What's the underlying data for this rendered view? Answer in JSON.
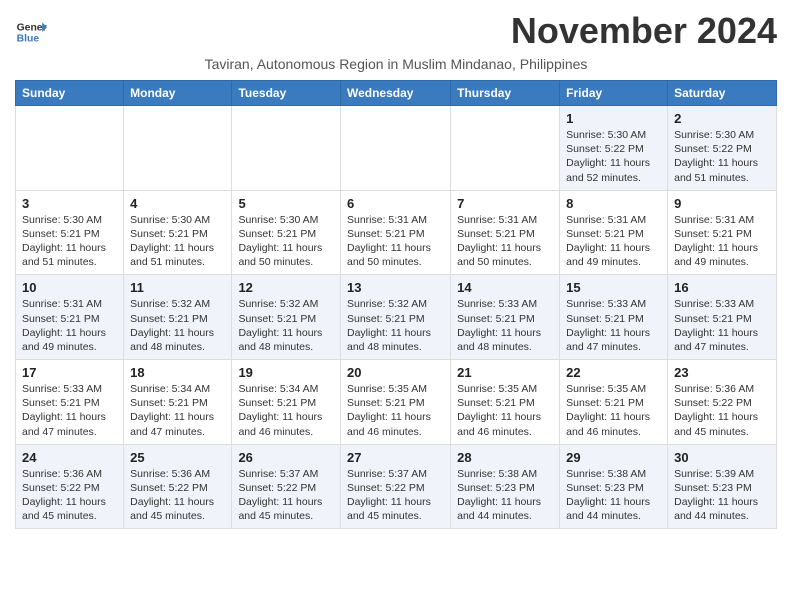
{
  "logo": {
    "line1": "General",
    "line2": "Blue"
  },
  "title": "November 2024",
  "subtitle": "Taviran, Autonomous Region in Muslim Mindanao, Philippines",
  "headers": [
    "Sunday",
    "Monday",
    "Tuesday",
    "Wednesday",
    "Thursday",
    "Friday",
    "Saturday"
  ],
  "weeks": [
    [
      {
        "day": "",
        "info": ""
      },
      {
        "day": "",
        "info": ""
      },
      {
        "day": "",
        "info": ""
      },
      {
        "day": "",
        "info": ""
      },
      {
        "day": "",
        "info": ""
      },
      {
        "day": "1",
        "info": "Sunrise: 5:30 AM\nSunset: 5:22 PM\nDaylight: 11 hours\nand 52 minutes."
      },
      {
        "day": "2",
        "info": "Sunrise: 5:30 AM\nSunset: 5:22 PM\nDaylight: 11 hours\nand 51 minutes."
      }
    ],
    [
      {
        "day": "3",
        "info": "Sunrise: 5:30 AM\nSunset: 5:21 PM\nDaylight: 11 hours\nand 51 minutes."
      },
      {
        "day": "4",
        "info": "Sunrise: 5:30 AM\nSunset: 5:21 PM\nDaylight: 11 hours\nand 51 minutes."
      },
      {
        "day": "5",
        "info": "Sunrise: 5:30 AM\nSunset: 5:21 PM\nDaylight: 11 hours\nand 50 minutes."
      },
      {
        "day": "6",
        "info": "Sunrise: 5:31 AM\nSunset: 5:21 PM\nDaylight: 11 hours\nand 50 minutes."
      },
      {
        "day": "7",
        "info": "Sunrise: 5:31 AM\nSunset: 5:21 PM\nDaylight: 11 hours\nand 50 minutes."
      },
      {
        "day": "8",
        "info": "Sunrise: 5:31 AM\nSunset: 5:21 PM\nDaylight: 11 hours\nand 49 minutes."
      },
      {
        "day": "9",
        "info": "Sunrise: 5:31 AM\nSunset: 5:21 PM\nDaylight: 11 hours\nand 49 minutes."
      }
    ],
    [
      {
        "day": "10",
        "info": "Sunrise: 5:31 AM\nSunset: 5:21 PM\nDaylight: 11 hours\nand 49 minutes."
      },
      {
        "day": "11",
        "info": "Sunrise: 5:32 AM\nSunset: 5:21 PM\nDaylight: 11 hours\nand 48 minutes."
      },
      {
        "day": "12",
        "info": "Sunrise: 5:32 AM\nSunset: 5:21 PM\nDaylight: 11 hours\nand 48 minutes."
      },
      {
        "day": "13",
        "info": "Sunrise: 5:32 AM\nSunset: 5:21 PM\nDaylight: 11 hours\nand 48 minutes."
      },
      {
        "day": "14",
        "info": "Sunrise: 5:33 AM\nSunset: 5:21 PM\nDaylight: 11 hours\nand 48 minutes."
      },
      {
        "day": "15",
        "info": "Sunrise: 5:33 AM\nSunset: 5:21 PM\nDaylight: 11 hours\nand 47 minutes."
      },
      {
        "day": "16",
        "info": "Sunrise: 5:33 AM\nSunset: 5:21 PM\nDaylight: 11 hours\nand 47 minutes."
      }
    ],
    [
      {
        "day": "17",
        "info": "Sunrise: 5:33 AM\nSunset: 5:21 PM\nDaylight: 11 hours\nand 47 minutes."
      },
      {
        "day": "18",
        "info": "Sunrise: 5:34 AM\nSunset: 5:21 PM\nDaylight: 11 hours\nand 47 minutes."
      },
      {
        "day": "19",
        "info": "Sunrise: 5:34 AM\nSunset: 5:21 PM\nDaylight: 11 hours\nand 46 minutes."
      },
      {
        "day": "20",
        "info": "Sunrise: 5:35 AM\nSunset: 5:21 PM\nDaylight: 11 hours\nand 46 minutes."
      },
      {
        "day": "21",
        "info": "Sunrise: 5:35 AM\nSunset: 5:21 PM\nDaylight: 11 hours\nand 46 minutes."
      },
      {
        "day": "22",
        "info": "Sunrise: 5:35 AM\nSunset: 5:21 PM\nDaylight: 11 hours\nand 46 minutes."
      },
      {
        "day": "23",
        "info": "Sunrise: 5:36 AM\nSunset: 5:22 PM\nDaylight: 11 hours\nand 45 minutes."
      }
    ],
    [
      {
        "day": "24",
        "info": "Sunrise: 5:36 AM\nSunset: 5:22 PM\nDaylight: 11 hours\nand 45 minutes."
      },
      {
        "day": "25",
        "info": "Sunrise: 5:36 AM\nSunset: 5:22 PM\nDaylight: 11 hours\nand 45 minutes."
      },
      {
        "day": "26",
        "info": "Sunrise: 5:37 AM\nSunset: 5:22 PM\nDaylight: 11 hours\nand 45 minutes."
      },
      {
        "day": "27",
        "info": "Sunrise: 5:37 AM\nSunset: 5:22 PM\nDaylight: 11 hours\nand 45 minutes."
      },
      {
        "day": "28",
        "info": "Sunrise: 5:38 AM\nSunset: 5:23 PM\nDaylight: 11 hours\nand 44 minutes."
      },
      {
        "day": "29",
        "info": "Sunrise: 5:38 AM\nSunset: 5:23 PM\nDaylight: 11 hours\nand 44 minutes."
      },
      {
        "day": "30",
        "info": "Sunrise: 5:39 AM\nSunset: 5:23 PM\nDaylight: 11 hours\nand 44 minutes."
      }
    ]
  ]
}
